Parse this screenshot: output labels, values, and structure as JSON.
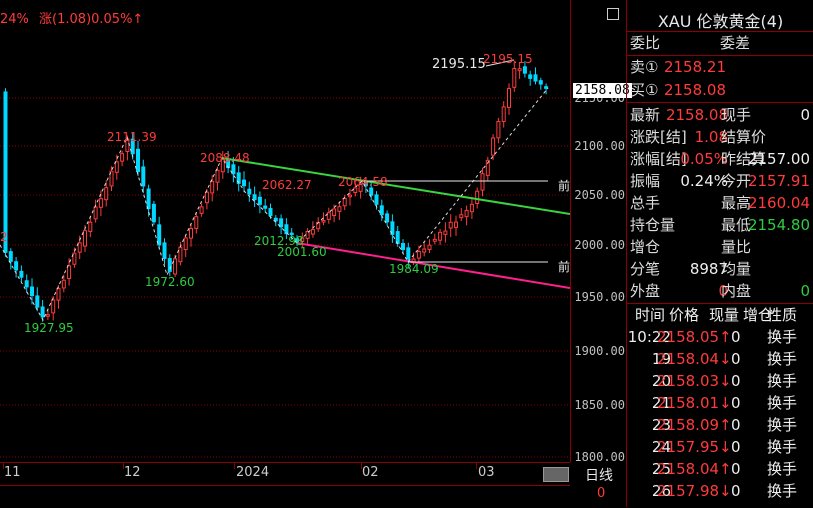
{
  "top": {
    "pct": "24%",
    "change_label": "涨(1.08)0.05%↑"
  },
  "colors": {
    "up": "#ff3b3b",
    "down": "#00d8ff",
    "green": "#2ecc40",
    "magenta": "#ff1f8f",
    "grid": "#8b0000"
  },
  "price_axis": {
    "ticks": [
      "2150.00",
      "2100.00",
      "2050.00",
      "2000.00",
      "1950.00",
      "1900.00",
      "1850.00",
      "1800.00"
    ],
    "current": "2158.08",
    "bottom": "0"
  },
  "time_axis": {
    "labels": [
      "11",
      "12",
      "2024",
      "02",
      "03"
    ],
    "period": "日线"
  },
  "annotations": {
    "hi1": "2111.39",
    "lo1": "1927.95",
    "lo2": "1972.60",
    "hi2": "2088.48",
    "mid1": "2062.27",
    "mid2": "2012.98",
    "lo3": "2001.60",
    "mid3": "2064.58",
    "lo4": "1984.09",
    "peak_left": "2195.15",
    "peak_right": "2195.15",
    "left_edge": "2",
    "front1": "前",
    "front2": "前"
  },
  "quote": {
    "title": "XAU 伦敦黄金(4)",
    "ratio_label": "委比",
    "diff_label": "委差",
    "sell_label": "卖①",
    "sell_val": "2158.21",
    "buy_label": "买①",
    "buy_val": "2158.08",
    "rows": [
      {
        "l1": "最新",
        "v1": "2158.08",
        "c1": "red",
        "l2": "现手",
        "v2": "0",
        "c2": "white"
      },
      {
        "l1": "涨跌[结]",
        "v1": "1.08",
        "c1": "red",
        "l2": "结算价",
        "v2": "",
        "c2": "white"
      },
      {
        "l1": "涨幅[结]",
        "v1": "0.05%",
        "c1": "red",
        "l2": "昨结算",
        "v2": "2157.00",
        "c2": "white"
      },
      {
        "l1": "振幅",
        "v1": "0.24%",
        "c1": "white",
        "l2": "今开",
        "v2": "2157.91",
        "c2": "red"
      },
      {
        "l1": "总手",
        "v1": "",
        "c1": "white",
        "l2": "最高",
        "v2": "2160.04",
        "c2": "red"
      },
      {
        "l1": "持仓量",
        "v1": "",
        "c1": "white",
        "l2": "最低",
        "v2": "2154.80",
        "c2": "green"
      },
      {
        "l1": "增仓",
        "v1": "",
        "c1": "white",
        "l2": "量比",
        "v2": "",
        "c2": "white"
      },
      {
        "l1": "分笔",
        "v1": "8987",
        "c1": "white",
        "l2": "均量",
        "v2": "",
        "c2": "white"
      },
      {
        "l1": "外盘",
        "v1": "0",
        "c1": "red",
        "l2": "内盘",
        "v2": "0",
        "c2": "green"
      }
    ],
    "ticks_header": [
      "时间",
      "价格",
      "现量",
      "增仓",
      "性质"
    ],
    "ticks": [
      {
        "time": "10:22",
        "price": "2158.05↑",
        "dir": "up",
        "vol": "0",
        "nature": "换手"
      },
      {
        "time": "19",
        "price": "2158.04↓",
        "dir": "down",
        "vol": "0",
        "nature": "换手"
      },
      {
        "time": "20",
        "price": "2158.03↓",
        "dir": "down",
        "vol": "0",
        "nature": "换手"
      },
      {
        "time": "21",
        "price": "2158.01↓",
        "dir": "down",
        "vol": "0",
        "nature": "换手"
      },
      {
        "time": "23",
        "price": "2158.09↑",
        "dir": "up",
        "vol": "0",
        "nature": "换手"
      },
      {
        "time": "24",
        "price": "2157.95↓",
        "dir": "down",
        "vol": "0",
        "nature": "换手"
      },
      {
        "time": "25",
        "price": "2158.04↑",
        "dir": "up",
        "vol": "0",
        "nature": "换手"
      },
      {
        "time": "26",
        "price": "2157.98↓",
        "dir": "down",
        "vol": "0",
        "nature": "换手"
      }
    ]
  }
}
